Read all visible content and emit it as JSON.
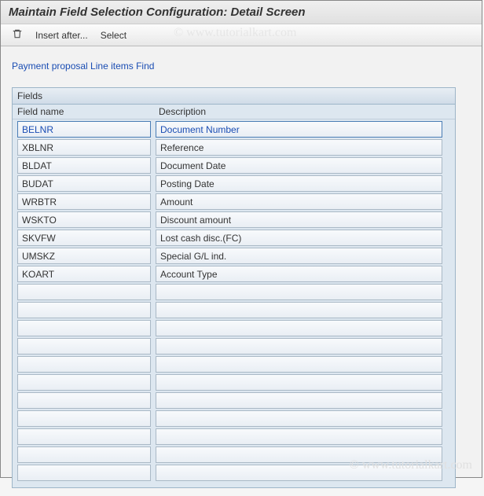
{
  "title": "Maintain Field Selection Configuration: Detail Screen",
  "toolbar": {
    "insert_after_label": "Insert after...",
    "select_label": "Select"
  },
  "breadcrumb": "Payment proposal Line items Find",
  "fields_box": {
    "header": "Fields",
    "col_fieldname": "Field name",
    "col_description": "Description"
  },
  "rows": [
    {
      "field": "BELNR",
      "desc": "Document Number",
      "selected": true
    },
    {
      "field": "XBLNR",
      "desc": "Reference",
      "selected": false
    },
    {
      "field": "BLDAT",
      "desc": "Document Date",
      "selected": false
    },
    {
      "field": "BUDAT",
      "desc": "Posting Date",
      "selected": false
    },
    {
      "field": "WRBTR",
      "desc": "Amount",
      "selected": false
    },
    {
      "field": "WSKTO",
      "desc": "Discount amount",
      "selected": false
    },
    {
      "field": "SKVFW",
      "desc": "Lost cash disc.(FC)",
      "selected": false
    },
    {
      "field": "UMSKZ",
      "desc": "Special G/L ind.",
      "selected": false
    },
    {
      "field": "KOART",
      "desc": "Account Type",
      "selected": false
    },
    {
      "field": "",
      "desc": "",
      "selected": false
    },
    {
      "field": "",
      "desc": "",
      "selected": false
    },
    {
      "field": "",
      "desc": "",
      "selected": false
    },
    {
      "field": "",
      "desc": "",
      "selected": false
    },
    {
      "field": "",
      "desc": "",
      "selected": false
    },
    {
      "field": "",
      "desc": "",
      "selected": false
    },
    {
      "field": "",
      "desc": "",
      "selected": false
    },
    {
      "field": "",
      "desc": "",
      "selected": false
    },
    {
      "field": "",
      "desc": "",
      "selected": false
    },
    {
      "field": "",
      "desc": "",
      "selected": false
    },
    {
      "field": "",
      "desc": "",
      "selected": false
    }
  ],
  "watermark": "© www.tutorialkart.com",
  "watermark2": "© www.tutorialkart.com"
}
